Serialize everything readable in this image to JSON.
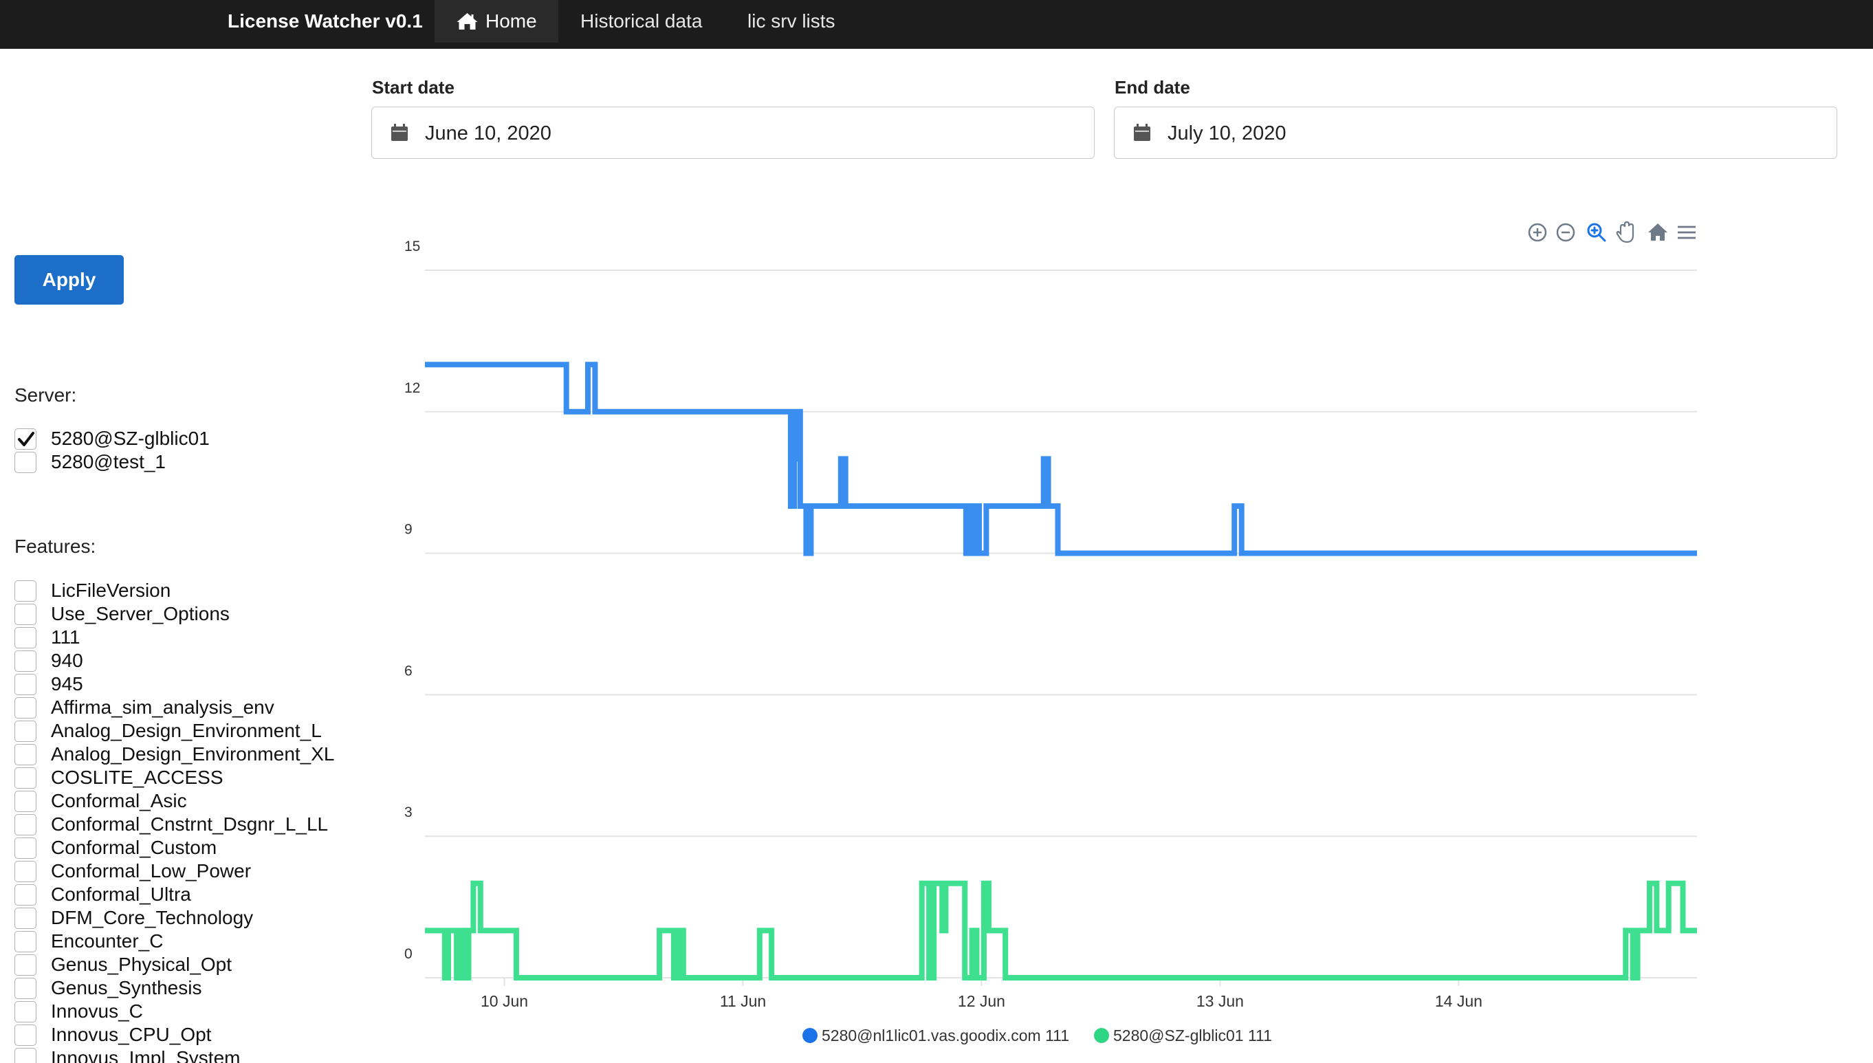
{
  "navbar": {
    "brand": "License Watcher v0.1",
    "items": [
      {
        "label": "Home",
        "icon": "home-icon",
        "active": true
      },
      {
        "label": "Historical data",
        "active": false
      },
      {
        "label": "lic srv lists",
        "active": false
      }
    ]
  },
  "filters": {
    "start_label": "Start date",
    "start_value": "June 10, 2020",
    "end_label": "End date",
    "end_value": "July 10, 2020",
    "apply_label": "Apply"
  },
  "servers": {
    "title": "Server:",
    "items": [
      {
        "label": "5280@SZ-glblic01",
        "checked": true
      },
      {
        "label": "5280@test_1",
        "checked": false
      }
    ]
  },
  "features": {
    "title": "Features:",
    "items": [
      "LicFileVersion",
      "Use_Server_Options",
      "111",
      "940",
      "945",
      "Affirma_sim_analysis_env",
      "Analog_Design_Environment_L",
      "Analog_Design_Environment_XL",
      "COSLITE_ACCESS",
      "Conformal_Asic",
      "Conformal_Cnstrnt_Dsgnr_L_LL",
      "Conformal_Custom",
      "Conformal_Low_Power",
      "Conformal_Ultra",
      "DFM_Core_Technology",
      "Encounter_C",
      "Genus_Physical_Opt",
      "Genus_Synthesis",
      "Innovus_C",
      "Innovus_CPU_Opt",
      "Innovus_Impl_System"
    ]
  },
  "chart_toolbar": [
    "zoom-in-icon",
    "zoom-out-icon",
    "selection-zoom-icon",
    "pan-hand-icon",
    "reset-home-icon",
    "menu-icon"
  ],
  "colors": {
    "blue": "#3a8ef0",
    "green": "#3ee08f",
    "accent": "#1c6ec8",
    "legend_blue": "#1a73e8",
    "legend_green": "#2ed582"
  },
  "chart_data": {
    "type": "line",
    "ylim": [
      0,
      15
    ],
    "yticks": [
      "15",
      "12",
      "9",
      "6",
      "3",
      "0"
    ],
    "xlim": [
      9.667,
      14.999
    ],
    "xticks": [
      {
        "x": 10,
        "label": "10 Jun"
      },
      {
        "x": 11,
        "label": "11 Jun"
      },
      {
        "x": 12,
        "label": "12 Jun"
      },
      {
        "x": 13,
        "label": "13 Jun"
      },
      {
        "x": 14,
        "label": "14 Jun"
      }
    ],
    "grid": true,
    "legend": "bottom-center",
    "series": [
      {
        "name": "5280@nl1lic01.vas.goodix.com 111",
        "color": "#3a8ef0",
        "points": [
          [
            9.667,
            13
          ],
          [
            10.26,
            13
          ],
          [
            10.26,
            12
          ],
          [
            10.35,
            12
          ],
          [
            10.35,
            13
          ],
          [
            10.38,
            13
          ],
          [
            10.38,
            12
          ],
          [
            11.2,
            12
          ],
          [
            11.2,
            10
          ],
          [
            11.215,
            10
          ],
          [
            11.215,
            12
          ],
          [
            11.225,
            12
          ],
          [
            11.225,
            11
          ],
          [
            11.235,
            11
          ],
          [
            11.235,
            12
          ],
          [
            11.24,
            12
          ],
          [
            11.24,
            10
          ],
          [
            11.265,
            10
          ],
          [
            11.265,
            9
          ],
          [
            11.285,
            9
          ],
          [
            11.285,
            10
          ],
          [
            11.41,
            10
          ],
          [
            11.41,
            11
          ],
          [
            11.43,
            11
          ],
          [
            11.43,
            10
          ],
          [
            11.935,
            10
          ],
          [
            11.935,
            9
          ],
          [
            11.95,
            9
          ],
          [
            11.95,
            10
          ],
          [
            11.965,
            10
          ],
          [
            11.965,
            9
          ],
          [
            11.98,
            9
          ],
          [
            11.98,
            10
          ],
          [
            11.99,
            10
          ],
          [
            11.99,
            9
          ],
          [
            12.02,
            9
          ],
          [
            12.02,
            10
          ],
          [
            12.26,
            10
          ],
          [
            12.26,
            11
          ],
          [
            12.28,
            11
          ],
          [
            12.28,
            10
          ],
          [
            12.32,
            10
          ],
          [
            12.32,
            9
          ],
          [
            13.06,
            9
          ],
          [
            13.06,
            10
          ],
          [
            13.09,
            10
          ],
          [
            13.09,
            9
          ],
          [
            14.999,
            9
          ]
        ]
      },
      {
        "name": "5280@SZ-glblic01 111",
        "color": "#3ee08f",
        "points": [
          [
            9.667,
            1
          ],
          [
            9.75,
            1
          ],
          [
            9.75,
            0
          ],
          [
            9.765,
            0
          ],
          [
            9.765,
            1
          ],
          [
            9.8,
            1
          ],
          [
            9.8,
            0
          ],
          [
            9.8,
            0
          ],
          [
            9.8,
            0
          ],
          [
            9.82,
            0
          ],
          [
            9.82,
            1
          ],
          [
            9.835,
            1
          ],
          [
            9.835,
            0
          ],
          [
            9.85,
            0
          ],
          [
            9.85,
            1
          ],
          [
            9.87,
            1
          ],
          [
            9.87,
            2
          ],
          [
            9.9,
            2
          ],
          [
            9.9,
            1
          ],
          [
            10.05,
            1
          ],
          [
            10.05,
            0
          ],
          [
            10.65,
            0
          ],
          [
            10.65,
            1
          ],
          [
            10.71,
            1
          ],
          [
            10.71,
            0
          ],
          [
            10.73,
            0
          ],
          [
            10.73,
            1
          ],
          [
            10.75,
            1
          ],
          [
            10.75,
            0
          ],
          [
            11.07,
            0
          ],
          [
            11.07,
            1
          ],
          [
            11.12,
            1
          ],
          [
            11.12,
            0
          ],
          [
            11.75,
            0
          ],
          [
            11.75,
            2
          ],
          [
            11.78,
            2
          ],
          [
            11.78,
            0
          ],
          [
            11.8,
            0
          ],
          [
            11.8,
            2
          ],
          [
            11.835,
            2
          ],
          [
            11.835,
            1
          ],
          [
            11.85,
            1
          ],
          [
            11.85,
            2
          ],
          [
            11.93,
            2
          ],
          [
            11.93,
            0
          ],
          [
            11.96,
            0
          ],
          [
            11.96,
            1
          ],
          [
            11.98,
            1
          ],
          [
            11.98,
            0
          ],
          [
            12.01,
            0
          ],
          [
            12.01,
            2
          ],
          [
            12.03,
            2
          ],
          [
            12.03,
            1
          ],
          [
            12.1,
            1
          ],
          [
            12.1,
            0
          ],
          [
            14.7,
            0
          ],
          [
            14.7,
            1
          ],
          [
            14.73,
            1
          ],
          [
            14.73,
            0
          ],
          [
            14.75,
            0
          ],
          [
            14.75,
            1
          ],
          [
            14.8,
            1
          ],
          [
            14.8,
            2
          ],
          [
            14.83,
            2
          ],
          [
            14.83,
            1
          ],
          [
            14.88,
            1
          ],
          [
            14.88,
            2
          ],
          [
            14.94,
            2
          ],
          [
            14.94,
            1
          ],
          [
            14.999,
            1
          ]
        ]
      }
    ]
  }
}
